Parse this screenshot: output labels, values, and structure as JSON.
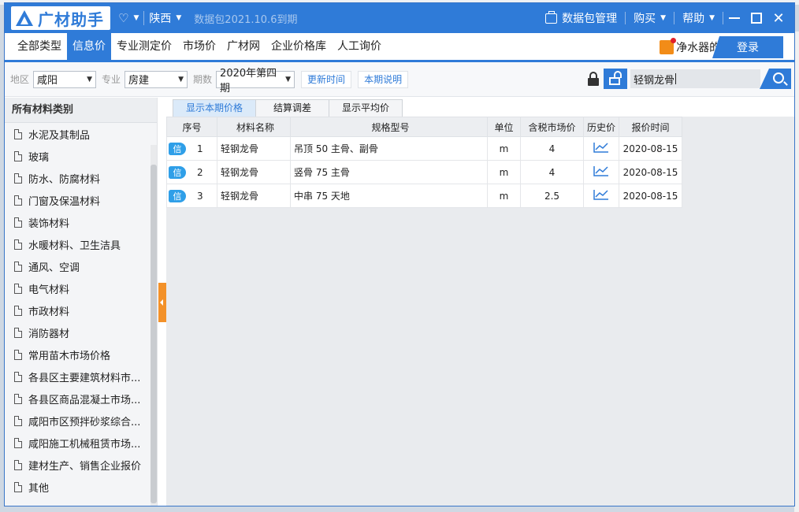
{
  "app": {
    "logo_text": "广材助手",
    "region": "陕西",
    "db_date": "数据包2021.10.6到期",
    "data_manage": "数据包管理",
    "buy": "购买",
    "help": "帮助"
  },
  "nav": {
    "tabs": [
      "全部类型",
      "信息价",
      "专业测定价",
      "市场价",
      "广材网",
      "企业价格库",
      "人工询价"
    ],
    "active_index": 1,
    "promo": "净水器的i",
    "login": "登录"
  },
  "filters": {
    "area_label": "地区",
    "area_value": "咸阳",
    "major_label": "专业",
    "major_value": "房建",
    "period_label": "期数",
    "period_value": "2020年第四期",
    "update_time_btn": "更新时间",
    "period_note_btn": "本期说明",
    "search_value": "轻钢龙骨"
  },
  "sidebar": {
    "header": "所有材料类别",
    "items": [
      "水泥及其制品",
      "玻璃",
      "防水、防腐材料",
      "门窗及保温材料",
      "装饰材料",
      "水暖材料、卫生洁具",
      "通风、空调",
      "电气材料",
      "市政材料",
      "消防器材",
      "常用苗木市场价格",
      "各县区主要建筑材料市...",
      "各县区商品混凝土市场...",
      "咸阳市区预拌砂浆综合...",
      "咸阳施工机械租赁市场...",
      "建材生产、销售企业报价",
      "其他"
    ]
  },
  "subtabs": [
    "显示本期价格",
    "结算调差",
    "显示平均价"
  ],
  "table": {
    "headers": [
      "序号",
      "材料名称",
      "规格型号",
      "单位",
      "含税市场价",
      "历史价",
      "报价时间"
    ],
    "badge": "信",
    "rows": [
      {
        "seq": "1",
        "name": "轻钢龙骨",
        "spec": "吊顶 50 主骨、副骨",
        "unit": "m",
        "price": "4",
        "date": "2020-08-15"
      },
      {
        "seq": "2",
        "name": "轻钢龙骨",
        "spec": "竖骨 75 主骨",
        "unit": "m",
        "price": "4",
        "date": "2020-08-15"
      },
      {
        "seq": "3",
        "name": "轻钢龙骨",
        "spec": "中串 75 天地",
        "unit": "m",
        "price": "2.5",
        "date": "2020-08-15"
      }
    ]
  },
  "colors": {
    "accent": "#2f7bd8",
    "handle": "#f39129",
    "badge": "#2f9fe8"
  }
}
